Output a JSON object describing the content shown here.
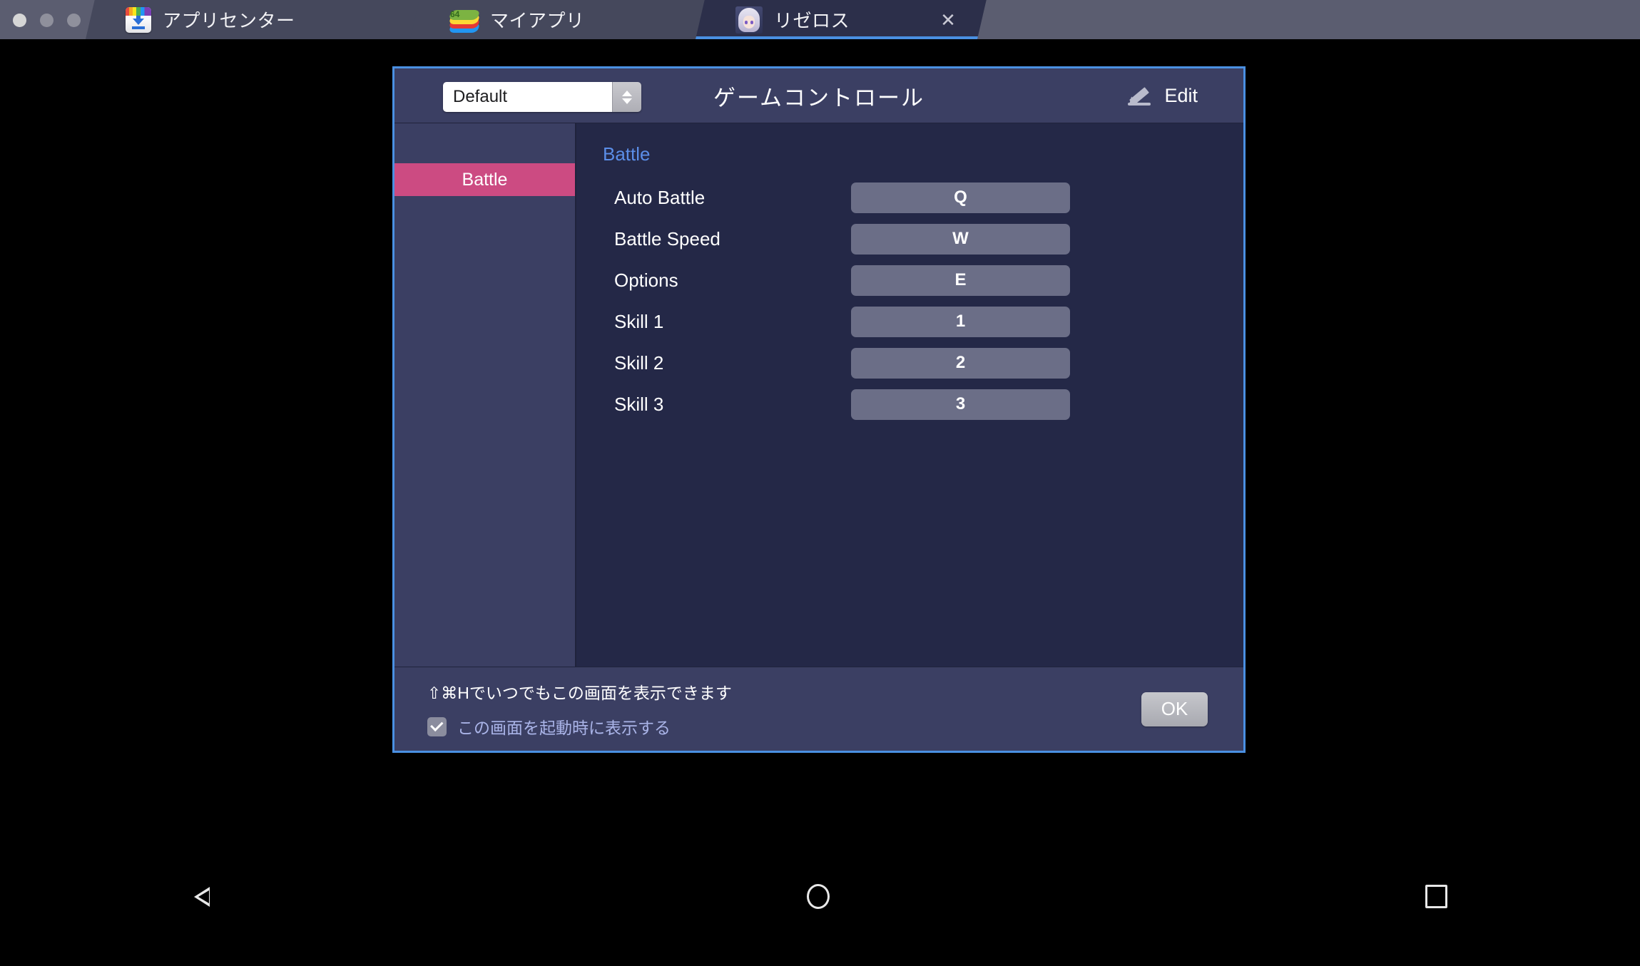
{
  "window": {
    "traffic_lights": [
      "close",
      "minimize",
      "zoom"
    ]
  },
  "tabs": [
    {
      "icon": "app-center-icon",
      "label": "アプリセンター",
      "active": false,
      "closable": false
    },
    {
      "icon": "bluestacks-logo-icon",
      "label": "マイアプリ",
      "badge": "64",
      "active": false,
      "closable": false
    },
    {
      "icon": "game-avatar-icon",
      "label": "リゼロス",
      "active": true,
      "closable": true,
      "close_glyph": "✕"
    }
  ],
  "dialog": {
    "title": "ゲームコントロール",
    "profile_select": {
      "value": "Default",
      "up_glyph": "chevron-up",
      "down_glyph": "chevron-down"
    },
    "edit": {
      "icon": "pencil-icon",
      "label": "Edit"
    },
    "sidebar": {
      "items": [
        {
          "label": "Battle",
          "selected": true
        }
      ]
    },
    "content": {
      "section_title": "Battle",
      "bindings": [
        {
          "label": "Auto Battle",
          "key": "Q"
        },
        {
          "label": "Battle Speed",
          "key": "W"
        },
        {
          "label": "Options",
          "key": "E"
        },
        {
          "label": "Skill 1",
          "key": "1"
        },
        {
          "label": "Skill 2",
          "key": "2"
        },
        {
          "label": "Skill 3",
          "key": "3"
        }
      ]
    },
    "footer": {
      "hint": "⇧⌘Hでいつでもこの画面を表示できます",
      "checkbox_label": "この画面を起動時に表示する",
      "checkbox_checked": true,
      "ok_label": "OK"
    }
  },
  "android_navbar": {
    "back": "back-triangle-icon",
    "home": "home-circle-icon",
    "recents": "recents-square-icon"
  },
  "colors": {
    "dialog_border": "#4a90e2",
    "header_bg": "#3b3f63",
    "content_bg": "#242847",
    "sidebar_selected": "#cc4b82",
    "section_title": "#5b8ee8",
    "key_button": "#6b6e87",
    "checkbox_label": "#aab4e8"
  }
}
